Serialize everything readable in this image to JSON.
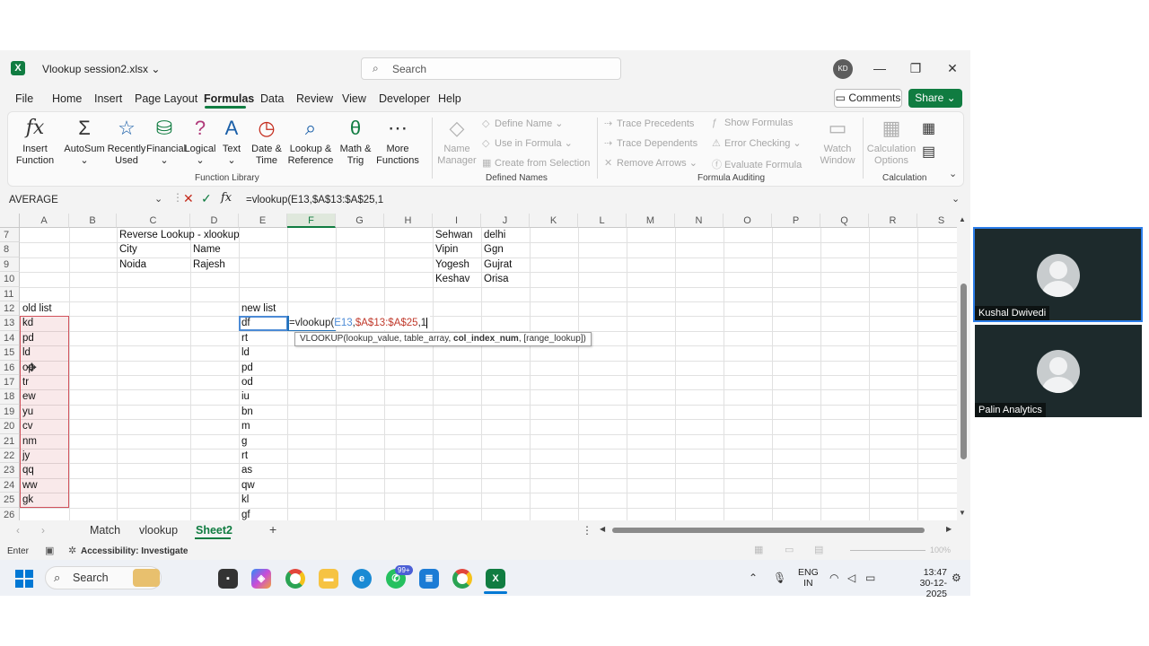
{
  "window": {
    "file_title": "Vlookup session2.xlsx ⌄",
    "search_placeholder": "Search",
    "avatar_initials": "KD"
  },
  "menu": {
    "tabs": [
      "File",
      "Home",
      "Insert",
      "Page Layout",
      "Formulas",
      "Data",
      "Review",
      "View",
      "Developer",
      "Help"
    ],
    "active_tab": "Formulas",
    "comments_label": "Comments",
    "share_label": "Share ⌄"
  },
  "ribbon": {
    "function_library": {
      "label": "Function Library",
      "buttons": [
        "Insert Function",
        "AutoSum",
        "Recently Used",
        "Financial",
        "Logical",
        "Text",
        "Date & Time",
        "Lookup & Reference",
        "Math & Trig",
        "More Functions"
      ]
    },
    "defined_names": {
      "label": "Defined Names",
      "name_manager": "Name Manager",
      "define_name": "Define Name",
      "use_in_formula": "Use in Formula",
      "create_from_selection": "Create from Selection"
    },
    "formula_auditing": {
      "label": "Formula Auditing",
      "trace_precedents": "Trace Precedents",
      "trace_dependents": "Trace Dependents",
      "remove_arrows": "Remove Arrows",
      "show_formulas": "Show Formulas",
      "error_checking": "Error Checking",
      "evaluate_formula": "Evaluate Formula",
      "watch_window": "Watch Window"
    },
    "calculation": {
      "label": "Calculation",
      "calculation_options": "Calculation Options"
    }
  },
  "formula_bar": {
    "name_box": "AVERAGE",
    "formula": "=vlookup(E13,$A$13:$A$25,1"
  },
  "grid": {
    "columns": [
      "A",
      "B",
      "C",
      "D",
      "E",
      "F",
      "G",
      "H",
      "I",
      "J",
      "K",
      "L",
      "M",
      "N",
      "O",
      "P",
      "Q",
      "R",
      "S"
    ],
    "selected_column": "F",
    "rows": [
      "7",
      "8",
      "9",
      "10",
      "11",
      "12",
      "13",
      "14",
      "15",
      "16",
      "17",
      "18",
      "19",
      "20",
      "21",
      "22",
      "23",
      "24",
      "25",
      "26"
    ],
    "cells": {
      "C7": "Reverse Lookup  - xlookup",
      "C8": "City",
      "D8": "Name",
      "C9": "Noida",
      "D9": "Rajesh",
      "I7": "Sehwan",
      "J7": "delhi",
      "I8": "Vipin",
      "J8": "Ggn",
      "I9": "Yogesh",
      "J9": "Gujrat",
      "I10": "Keshav",
      "J10": "Orisa",
      "A12": "old list",
      "E12": "new list"
    },
    "old_list": [
      "kd",
      "pd",
      "ld",
      "op",
      "tr",
      "ew",
      "yu",
      "cv",
      "nm",
      "jy",
      "qq",
      "ww",
      "gk"
    ],
    "new_list": [
      "df",
      "rt",
      "ld",
      "pd",
      "od",
      "iu",
      "bn",
      "m",
      "g",
      "rt",
      "as",
      "qw",
      "kl",
      "gf"
    ],
    "edit": {
      "prefix": "=vlookup(",
      "ref1": "E13",
      "sep": ",",
      "ref2": "$A$13:$A$25",
      "suffix": ",1"
    },
    "tooltip": {
      "fn": "VLOOKUP(lookup_value, table_array, ",
      "current_arg": "col_index_num",
      "rest": ", [range_lookup])"
    }
  },
  "sheets": {
    "tabs": [
      "Match",
      "vlookup",
      "Sheet2"
    ],
    "active": "Sheet2",
    "add_label": "+"
  },
  "status": {
    "mode": "Enter",
    "accessibility": "Accessibility: Investigate",
    "zoom": "100%"
  },
  "taskbar": {
    "search_placeholder": "Search",
    "teams_badge": "99+",
    "lang_line1": "ENG",
    "lang_line2": "IN",
    "time": "13:47",
    "date": "30-12-2025"
  },
  "participants": [
    {
      "name": "Kushal Dwivedi",
      "active": true
    },
    {
      "name": "Palin Analytics",
      "active": false
    }
  ]
}
